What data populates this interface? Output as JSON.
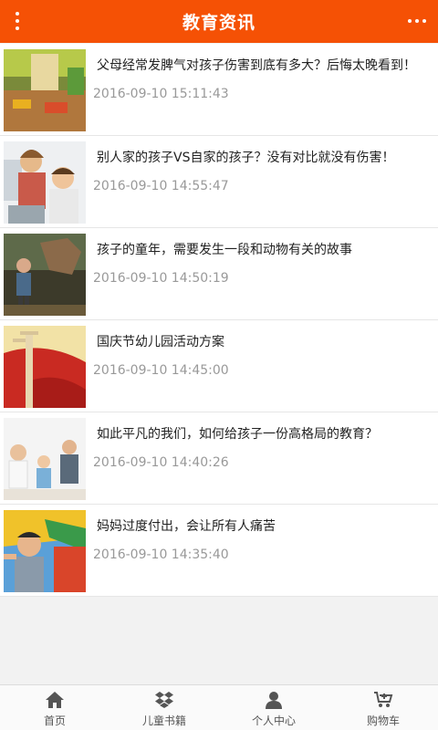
{
  "header": {
    "title": "教育资讯",
    "menu_icon": "vertical-dots-icon",
    "more_icon": "horizontal-dots-icon",
    "color": "#f55105"
  },
  "articles": [
    {
      "title": "父母经常发脾气对孩子伤害到底有多大？后悔太晚看到！",
      "date": "2016-09-10 15:11:43"
    },
    {
      "title": "别人家的孩子VS自家的孩子？没有对比就没有伤害！",
      "date": "2016-09-10 14:55:47"
    },
    {
      "title": "孩子的童年，需要发生一段和动物有关的故事",
      "date": "2016-09-10 14:50:19"
    },
    {
      "title": "国庆节幼儿园活动方案",
      "date": "2016-09-10 14:45:00"
    },
    {
      "title": "如此平凡的我们，如何给孩子一份高格局的教育？",
      "date": "2016-09-10 14:40:26"
    },
    {
      "title": "妈妈过度付出，会让所有人痛苦",
      "date": "2016-09-10 14:35:40"
    }
  ],
  "tabbar": [
    {
      "label": "首页",
      "icon": "home-icon"
    },
    {
      "label": "儿童书籍",
      "icon": "dropbox-icon"
    },
    {
      "label": "个人中心",
      "icon": "user-icon"
    },
    {
      "label": "购物车",
      "icon": "cart-icon"
    }
  ]
}
